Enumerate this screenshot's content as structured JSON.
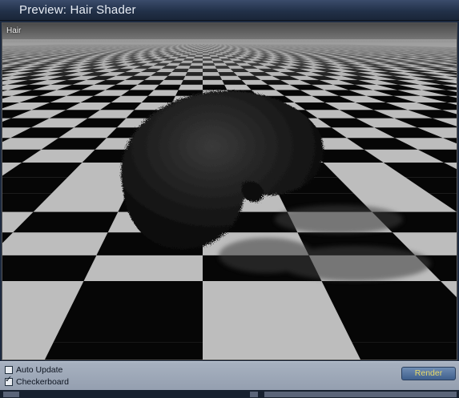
{
  "window": {
    "title": "Preview: Hair Shader"
  },
  "viewport": {
    "label": "Hair"
  },
  "controls": {
    "auto_update": {
      "label": "Auto Update",
      "checked": false
    },
    "checkerboard": {
      "label": "Checkerboard",
      "checked": true,
      "mark": "✓"
    },
    "render_label": "Render"
  },
  "colors": {
    "titlebar": "#223149",
    "panel": "#98a3b4",
    "render_text": "#e7d96a"
  }
}
